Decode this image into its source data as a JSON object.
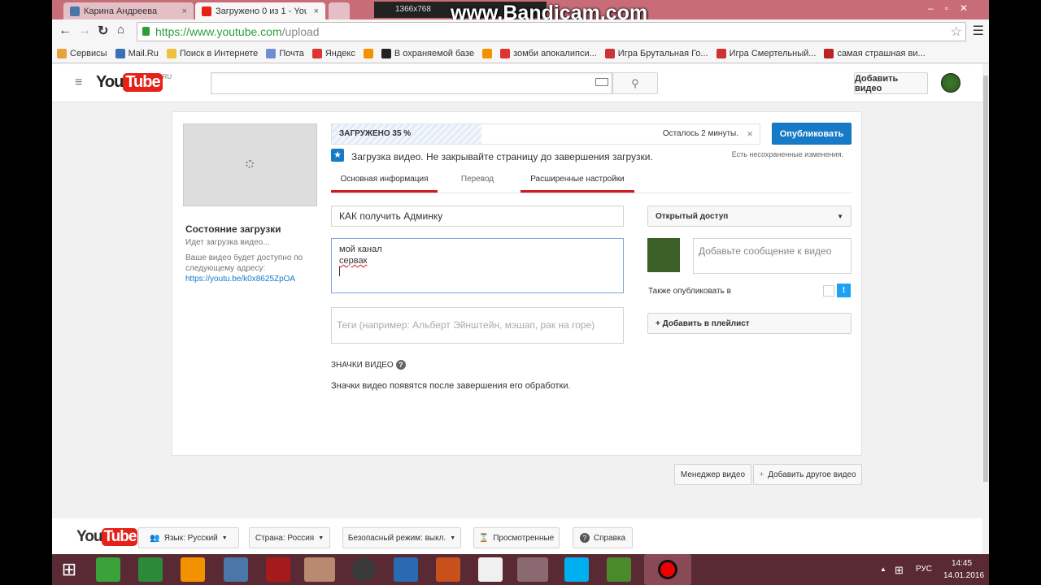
{
  "browser": {
    "tabs": [
      {
        "label": "Карина Андреева",
        "close": "×"
      },
      {
        "label": "Загружено 0 из 1 - YouTu",
        "close": "×"
      }
    ],
    "watermark": "www.Bandicam.com",
    "recorder_info": "1366x768",
    "url_host": "https://www.youtube.com",
    "url_path": "/upload",
    "bookmarks": [
      "Сервисы",
      "Mail.Ru",
      "Поиск в Интернете",
      "Почта",
      "Яндекс",
      "",
      "В охраняемой базе",
      "",
      "зомби апокалипси...",
      "Игра Брутальная Го...",
      "Игра Смертельный...",
      "самая страшная ви..."
    ],
    "bookmark_colors": [
      "#e8a33b",
      "#3b6fb6",
      "#f0c040",
      "#6d8fd0",
      "#d33",
      "#f39200",
      "#222",
      "#f39200",
      "#d33",
      "#c33",
      "#c33",
      "#b22"
    ]
  },
  "youtube": {
    "logo_you": "You",
    "logo_tube": "Tube",
    "region": "RU",
    "search_placeholder": "",
    "upload_button": "Добавить видео"
  },
  "upload": {
    "progress_label": "ЗАГРУЖЕНО 35 %",
    "progress_percent": 35,
    "time_left": "Осталось 2 минуты.",
    "cancel": "×",
    "publish_button": "Опубликовать",
    "notice": "Загрузка видео. Не закрывайте страницу до завершения загрузки.",
    "unsaved": "Есть несохраненные изменения.",
    "tabs": [
      "Основная информация",
      "Перевод",
      "Расширенные настройки"
    ],
    "status_title": "Состояние загрузки",
    "status_text": "Идет загрузка видео...",
    "address_text": "Ваше видео будет доступно по следующему адресу:",
    "video_url": "https://youtu.be/k0x8625ZpOA",
    "title_value": "КАК получить Админку",
    "description_lines": [
      "мой канал",
      "сервак"
    ],
    "tags_placeholder": "Теги (например: Альберт Эйнштейн, мэшап, рак на горе)",
    "thumbs_title": "ЗНАЧКИ ВИДЕО",
    "thumbs_text": "Значки видео появятся после завершения его обработки.",
    "privacy": "Открытый доступ",
    "message_placeholder": "Добавьте сообщение к видео",
    "also_publish": "Также опубликовать в",
    "add_playlist": "+ Добавить в плейлист",
    "video_manager": "Менеджер видео",
    "add_another": "Добавить другое видео"
  },
  "footer": {
    "language": "Язык: Русский",
    "country": "Страна: Россия",
    "safety": "Безопасный режим: выкл.",
    "history": "Просмотренные",
    "help": "Справка"
  },
  "taskbar": {
    "lang": "РУС",
    "time": "14:45",
    "date": "14.01.2016"
  },
  "colors": {
    "accent": "#167ac6",
    "yt_red": "#e62117",
    "tab_underline": "#cc181e"
  }
}
